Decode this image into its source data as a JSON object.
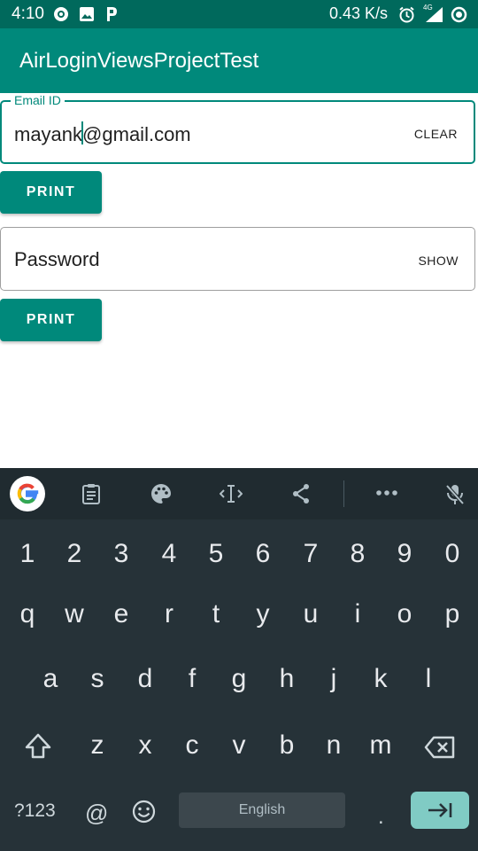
{
  "status_bar": {
    "time": "4:10",
    "network_speed": "0.43 K/s",
    "network_type": "4G",
    "icons": [
      "pocket-casts-icon",
      "image-icon",
      "p-icon",
      "alarm-icon",
      "signal-icon",
      "data-saver-icon"
    ]
  },
  "app_bar": {
    "title": "AirLoginViewsProjectTest"
  },
  "email": {
    "label": "Email ID",
    "value_before_cursor": "mayank",
    "value_after_cursor": "@gmail.com",
    "end_action": "CLEAR"
  },
  "password": {
    "placeholder": "Password",
    "end_action": "SHOW"
  },
  "buttons": {
    "print_label": "PRINT"
  },
  "keyboard": {
    "toolbar_icons": [
      "google-icon",
      "clipboard-icon",
      "palette-icon",
      "text-cursor-icon",
      "share-icon",
      "more-icon",
      "mic-off-icon"
    ],
    "number_row": [
      "1",
      "2",
      "3",
      "4",
      "5",
      "6",
      "7",
      "8",
      "9",
      "0"
    ],
    "row1": [
      "q",
      "w",
      "e",
      "r",
      "t",
      "y",
      "u",
      "i",
      "o",
      "p"
    ],
    "row2": [
      "a",
      "s",
      "d",
      "f",
      "g",
      "h",
      "j",
      "k",
      "l"
    ],
    "row3": [
      "z",
      "x",
      "c",
      "v",
      "b",
      "n",
      "m"
    ],
    "symbols_key": "?123",
    "at_key": "@",
    "period_key": ".",
    "space_label": "English"
  },
  "colors": {
    "status_bar": "#00695c",
    "primary": "#00897b",
    "keyboard_bg": "#263238",
    "enter_key": "#80cbc4"
  }
}
